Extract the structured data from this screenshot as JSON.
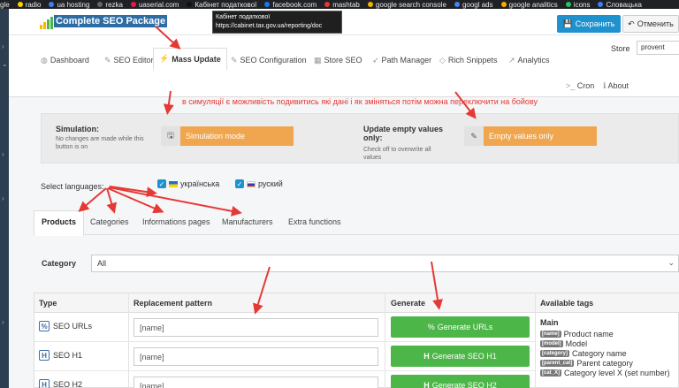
{
  "browser": {
    "bookmarks": [
      {
        "label": "gle",
        "color": "#202124"
      },
      {
        "label": "radio",
        "color": "#ffd000"
      },
      {
        "label": "ua hosting",
        "color": "#3b82f6"
      },
      {
        "label": "rezka",
        "color": "#666666"
      },
      {
        "label": "uaserial.com",
        "color": "#e11d48"
      },
      {
        "label": "Кабінет податкової",
        "color": "#111111"
      },
      {
        "label": "facebook.com",
        "color": "#1877f2"
      },
      {
        "label": "mashtab",
        "color": "#e53935"
      },
      {
        "label": "google search console",
        "color": "#f4b400"
      },
      {
        "label": "googl ads",
        "color": "#4285f4"
      },
      {
        "label": "google analitics",
        "color": "#f9ab00"
      },
      {
        "label": "icons",
        "color": "#22c55e"
      },
      {
        "label": "Словацька",
        "color": "#3b82f6"
      }
    ],
    "tooltip_title": "Кабінет податкової",
    "tooltip_url": "https://cabinet.tax.gov.ua/reporting/doc"
  },
  "header": {
    "title": "Complete SEO Package",
    "save_label": "Сохранить",
    "cancel_label": "Отменить"
  },
  "nav": {
    "items": [
      {
        "label": "Dashboard",
        "icon": "dashboard-icon",
        "glyph": "◍"
      },
      {
        "label": "SEO Editor",
        "icon": "edit-icon",
        "glyph": "✎"
      },
      {
        "label": "Mass Update",
        "icon": "bolt-icon",
        "glyph": "⚡"
      },
      {
        "label": "SEO Configuration",
        "icon": "wrench-icon",
        "glyph": "✎"
      },
      {
        "label": "Store SEO",
        "icon": "store-icon",
        "glyph": "▦"
      },
      {
        "label": "Path Manager",
        "icon": "send-icon",
        "glyph": "➶"
      },
      {
        "label": "Rich Snippets",
        "icon": "code-icon",
        "glyph": "◇"
      },
      {
        "label": "Analytics",
        "icon": "chart-icon",
        "glyph": "↗"
      }
    ],
    "cron_label": "Cron",
    "about_label": "About",
    "store_label": "Store",
    "store_value": "provent"
  },
  "annotations": {
    "top_note": "в симуляції є можливість подивитись які дані і як зміняться потім можна переключити на бойову"
  },
  "simulation": {
    "label": "Simulation:",
    "sub": "No changes are made while this button is on",
    "button_label": "Simulation mode",
    "empty_label": "Update empty values only:",
    "empty_sub": "Check off to overwrite all values",
    "empty_button": "Empty values only"
  },
  "languages": {
    "label": "Select languages:",
    "items": [
      {
        "name": "українська",
        "checked": true
      },
      {
        "name": "руский",
        "checked": true
      }
    ]
  },
  "tabs": [
    "Products",
    "Categories",
    "Informations pages",
    "Manufacturers",
    "Extra functions"
  ],
  "category": {
    "label": "Category",
    "value": "All"
  },
  "table": {
    "headers": [
      "Type",
      "Replacement pattern",
      "Generate",
      "Available tags"
    ],
    "rows": [
      {
        "type": "SEO URLs",
        "icon": "%",
        "pattern": "[name]",
        "button": "Generate URLs"
      },
      {
        "type": "SEO H1",
        "icon": "H",
        "pattern": "[name]",
        "button": "Generate SEO H1"
      },
      {
        "type": "SEO H2",
        "icon": "H",
        "pattern": "[name]",
        "button": "Generate SEO H2"
      }
    ],
    "tags_group": "Main",
    "tags": [
      {
        "tag": "[name]",
        "desc": "Product name"
      },
      {
        "tag": "[model]",
        "desc": "Model"
      },
      {
        "tag": "[category]",
        "desc": "Category name"
      },
      {
        "tag": "[parent_cat]",
        "desc": "Parent category"
      },
      {
        "tag": "[cat_X]",
        "desc": "Category level X (set number)"
      }
    ]
  },
  "colors": {
    "accent": "#1e91cf",
    "orange": "#f0a64e",
    "green": "#4cb648",
    "annotation": "#e53935"
  }
}
